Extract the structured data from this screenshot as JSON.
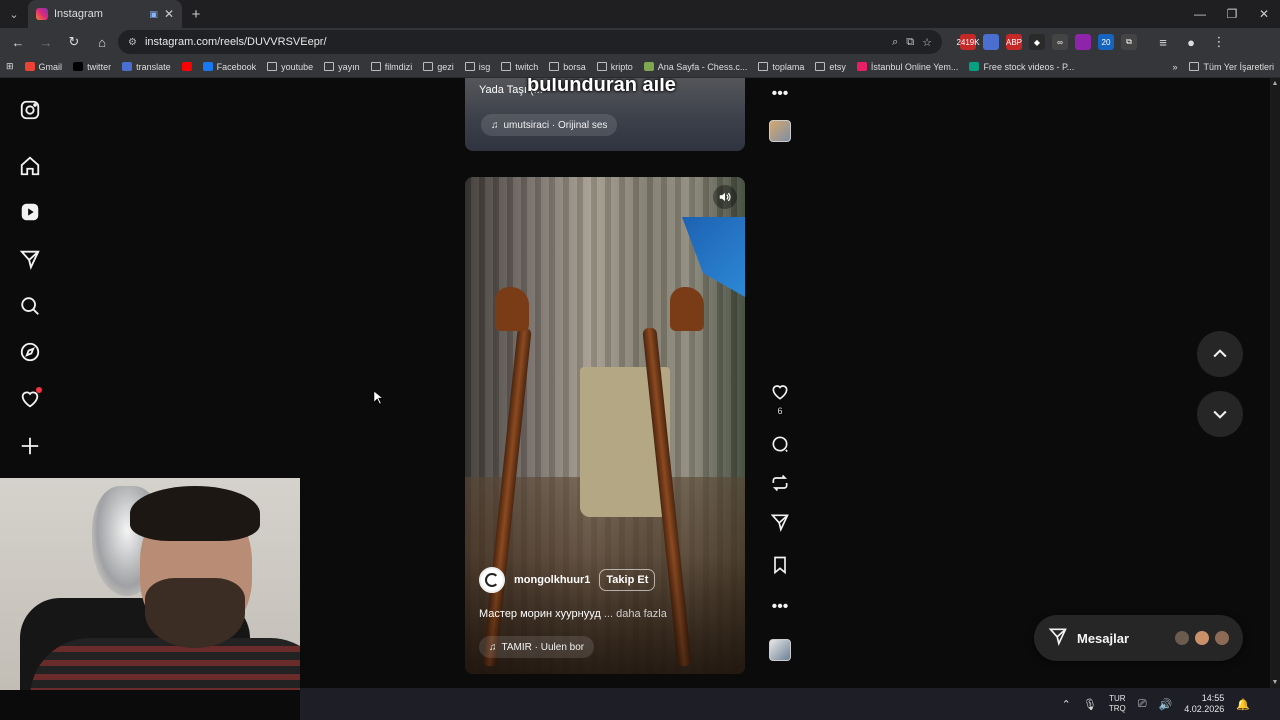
{
  "browser": {
    "tab_title": "Instagram",
    "tab_media_indicator": "▣",
    "url": "instagram.com/reels/DUVVRSVEepr/",
    "new_tab": "+",
    "window_controls": [
      "—",
      "❐",
      "✕"
    ]
  },
  "extensions": [
    {
      "name": "ext-badge",
      "label": "2419K",
      "color": "#c62828"
    },
    {
      "name": "translate-ext",
      "label": "",
      "color": "#4a6fd1"
    },
    {
      "name": "abp-ext",
      "label": "ABP",
      "color": "#c62828"
    },
    {
      "name": "diamond-ext",
      "label": "◆",
      "color": "#2a2a2a"
    },
    {
      "name": "glasses-ext",
      "label": "∞",
      "color": "#444"
    },
    {
      "name": "purple-ext",
      "label": "",
      "color": "#8e24aa"
    },
    {
      "name": "badge-20-ext",
      "label": "20",
      "color": "#1565c0"
    },
    {
      "name": "puzzle-ext",
      "label": "⧉",
      "color": "#444"
    }
  ],
  "bookmarks": [
    {
      "label": "Gmail",
      "color": "#ea4335"
    },
    {
      "label": "twitter",
      "color": "#000000"
    },
    {
      "label": "translate",
      "color": "#4a6fd1"
    },
    {
      "label": "",
      "color": "#ff0000"
    },
    {
      "label": "Facebook",
      "color": "#1877f2"
    },
    {
      "label": "youtube",
      "folder": true
    },
    {
      "label": "yayın",
      "folder": true
    },
    {
      "label": "filmdizi",
      "folder": true
    },
    {
      "label": "gezi",
      "folder": true
    },
    {
      "label": "isg",
      "folder": true
    },
    {
      "label": "twitch",
      "folder": true
    },
    {
      "label": "borsa",
      "folder": true
    },
    {
      "label": "kripto",
      "folder": true
    },
    {
      "label": "Ana Sayfa - Chess.c...",
      "color": "#7fa650"
    },
    {
      "label": "toplama",
      "folder": true
    },
    {
      "label": "etsy",
      "folder": true
    },
    {
      "label": "İstanbul Online Yem...",
      "color": "#e91e63"
    },
    {
      "label": "Free stock videos - P...",
      "color": "#05a081"
    }
  ],
  "bookmarks_overflow": "»",
  "bookmarks_all": "Tüm Yer İşaretleri",
  "prev_reel": {
    "overlay_text": "bulunduran aile",
    "caption": "Yada Taşı (...",
    "audio": "umutsiraci · Orijinal ses"
  },
  "reel": {
    "author": "mongolkhuur1",
    "follow_label": "Takip Et",
    "caption": "Мастер морин хуурнууд",
    "caption_more": "... daha fazla",
    "audio": "TAMIR · Uulen bor",
    "likes": "6"
  },
  "messages_label": "Mesajlar",
  "taskbar": {
    "lang_top": "TUR",
    "lang_bottom": "TRQ",
    "time": "14:55",
    "date": "4.02.2026"
  }
}
